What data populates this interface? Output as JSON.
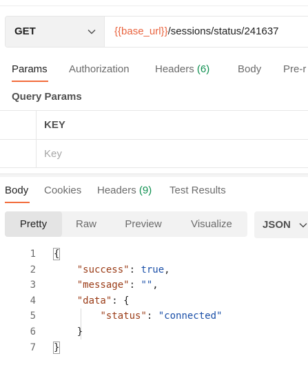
{
  "request": {
    "method": "GET",
    "url_variable": "{{base_url}}",
    "url_path": "/sessions/status/241637"
  },
  "request_tabs": [
    {
      "label": "Params",
      "count": "",
      "active": true
    },
    {
      "label": "Authorization",
      "count": "",
      "active": false
    },
    {
      "label": "Headers ",
      "count": "(6)",
      "active": false
    },
    {
      "label": "Body",
      "count": "",
      "active": false
    },
    {
      "label": "Pre-r",
      "count": "",
      "active": false
    }
  ],
  "query_params": {
    "title": "Query Params",
    "key_header": "KEY",
    "key_placeholder": "Key"
  },
  "response_tabs": [
    {
      "label": "Body",
      "count": "",
      "active": true
    },
    {
      "label": "Cookies",
      "count": "",
      "active": false
    },
    {
      "label": "Headers ",
      "count": "(9)",
      "active": false
    },
    {
      "label": "Test Results",
      "count": "",
      "active": false
    }
  ],
  "view_modes": [
    "Pretty",
    "Raw",
    "Preview",
    "Visualize"
  ],
  "active_view_mode": "Pretty",
  "format": "JSON",
  "code_lines": {
    "n1": "1",
    "n2": "2",
    "n3": "3",
    "n4": "4",
    "n5": "5",
    "n6": "6",
    "n7": "7",
    "open_brace": "{",
    "success_key": "\"success\"",
    "success_val": "true",
    "message_key": "\"message\"",
    "message_val": "\"\"",
    "data_key": "\"data\"",
    "data_open": "{",
    "status_key": "\"status\"",
    "status_val": "\"connected\"",
    "data_close": "}",
    "close_brace": "}"
  },
  "colors": {
    "accent": "#f26b3a",
    "variable": "#e9633e",
    "count": "#0d8f4f",
    "json_key": "#9a3b16",
    "json_value": "#1a4fa8"
  }
}
